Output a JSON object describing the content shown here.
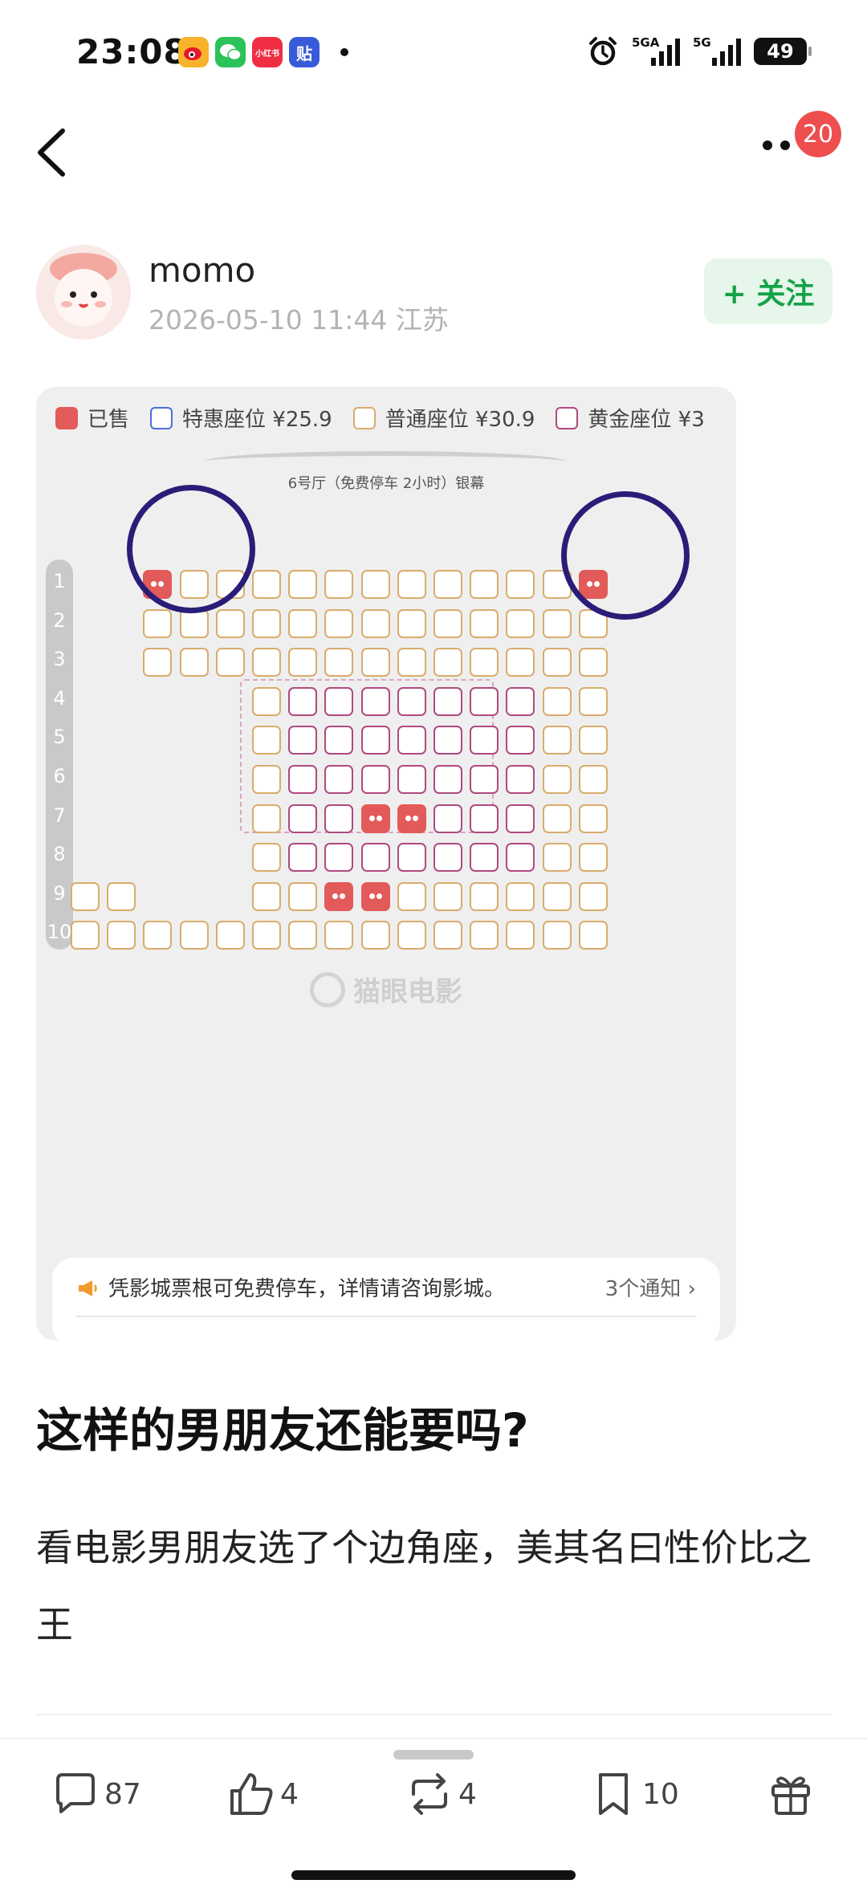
{
  "status_bar": {
    "time": "23:08",
    "app_icons": [
      {
        "name": "weibo-icon",
        "text": "",
        "color": "#f7b32b"
      },
      {
        "name": "wechat-icon",
        "text": "",
        "color": "#2bc25a"
      },
      {
        "name": "xiaohongshu-icon",
        "text": "小红书",
        "color": "#ef2d43"
      },
      {
        "name": "tieba-icon",
        "text": "贴",
        "color": "#3a5bd9"
      }
    ],
    "signal_1": "5GA",
    "signal_2": "5G",
    "battery": "49"
  },
  "nav": {
    "notification_count": "20"
  },
  "author": {
    "name": "momo",
    "meta": "2026-05-10 11:44  江苏",
    "follow_label": "+ 关注"
  },
  "seat_map": {
    "legend": [
      {
        "label": "已售",
        "kind": "sold",
        "color": "#e25a59"
      },
      {
        "label": "特惠座位 ¥25.9",
        "kind": "discount",
        "color": "#4a6fd8"
      },
      {
        "label": "普通座位 ¥30.9",
        "kind": "standard",
        "color": "#d9ac6b"
      },
      {
        "label": "黄金座位 ¥3",
        "kind": "gold",
        "color": "#b0497f"
      }
    ],
    "screen_label": "6号厅（免费停车 2小时）银幕",
    "row_labels": [
      "1",
      "2",
      "3",
      "4",
      "5",
      "6",
      "7",
      "8",
      "9",
      "10"
    ],
    "watermark": "猫眼电影",
    "notice_text": "凭影城票根可免费停车，详情请咨询影城。",
    "notice_link": "3个通知  ›"
  },
  "post": {
    "title": "这样的男朋友还能要吗?",
    "body": "看电影男朋友选了个边角座，美其名曰性价比之王"
  },
  "actions": {
    "comments": "87",
    "likes": "4",
    "reposts": "4",
    "favorites": "10"
  }
}
